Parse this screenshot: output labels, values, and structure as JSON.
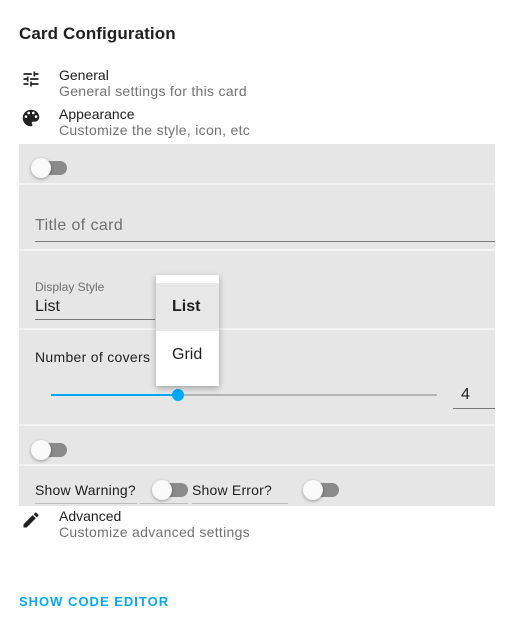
{
  "header": {
    "title": "Card Configuration"
  },
  "sections": {
    "general": {
      "label": "General",
      "desc": "General settings for this card",
      "icon": "tune-icon"
    },
    "appearance": {
      "label": "Appearance",
      "desc": "Customize the style, icon, etc",
      "icon": "palette-icon"
    },
    "advanced": {
      "label": "Advanced",
      "desc": "Customize advanced settings",
      "icon": "pencil-icon"
    }
  },
  "appearance_panel": {
    "toggle_1": {
      "checked": false
    },
    "title_field": {
      "placeholder": "Title of card",
      "value": ""
    },
    "display_style": {
      "label": "Display Style",
      "value": "List",
      "options": [
        "List",
        "Grid"
      ]
    },
    "covers": {
      "label": "Number of covers",
      "value": "4",
      "fraction": 0.33
    },
    "toggle_2": {
      "checked": false
    },
    "show_warning": {
      "label": "Show Warning?",
      "checked": false
    },
    "show_error": {
      "label": "Show Error?",
      "checked": false
    }
  },
  "footer": {
    "code_editor_label": "SHOW CODE EDITOR"
  },
  "colors": {
    "accent": "#03a9f4",
    "panel_bg": "#e6e6e6",
    "secondary_text": "#727272"
  }
}
